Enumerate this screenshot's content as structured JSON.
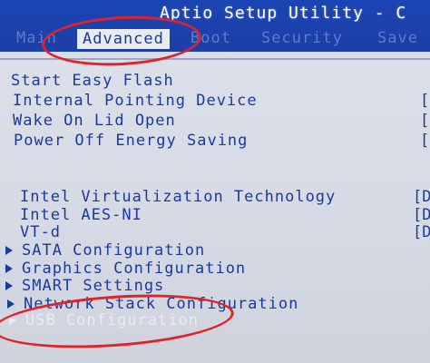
{
  "window": {
    "title": "Aptio Setup Utility - C"
  },
  "tabs": [
    {
      "label": "Main"
    },
    {
      "label": "Advanced"
    },
    {
      "label": "Boot"
    },
    {
      "label": "Security"
    },
    {
      "label": "Save"
    }
  ],
  "menu_top": [
    {
      "label": "Start Easy Flash"
    },
    {
      "label": "Internal Pointing Device",
      "value": "["
    },
    {
      "label": "Wake On Lid Open",
      "value": "["
    },
    {
      "label": "Power Off Energy Saving",
      "value": "["
    }
  ],
  "menu_bottom": [
    {
      "label": "Intel Virtualization Technology",
      "value": "[D"
    },
    {
      "label": "Intel AES-NI",
      "value": "[D"
    },
    {
      "label": "VT-d",
      "value": "[D"
    },
    {
      "label": "SATA Configuration"
    },
    {
      "label": "Graphics Configuration"
    },
    {
      "label": "SMART Settings"
    },
    {
      "label": "Network Stack Configuration"
    },
    {
      "label": "USB Configuration"
    }
  ],
  "colors": {
    "header_bg": "#1b44b4",
    "body_bg": "#d9dde6",
    "text": "#1a3a9c",
    "annotation": "#e0222a"
  }
}
